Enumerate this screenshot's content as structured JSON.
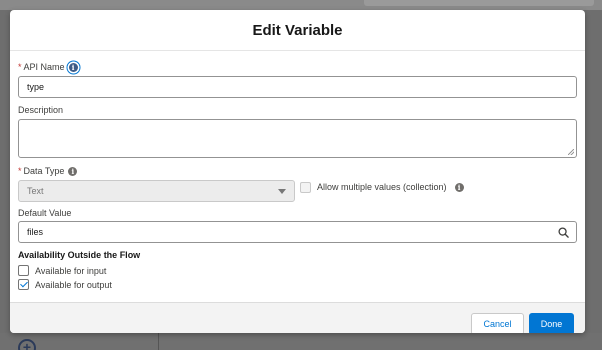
{
  "modal": {
    "title": "Edit Variable"
  },
  "fields": {
    "api_name": {
      "label": "API Name",
      "required": "*",
      "value": "type"
    },
    "description": {
      "label": "Description",
      "value": ""
    },
    "data_type": {
      "label": "Data Type",
      "required": "*",
      "value": "Text"
    },
    "allow_multiple": {
      "label": "Allow multiple values (collection)",
      "checked": false
    },
    "default_value": {
      "label": "Default Value",
      "value": "files"
    },
    "availability": {
      "title": "Availability Outside the Flow",
      "input_label": "Available for input",
      "input_checked": false,
      "output_label": "Available for output",
      "output_checked": true
    }
  },
  "footer": {
    "cancel_label": "Cancel",
    "done_label": "Done"
  },
  "icons": {
    "info": "info-icon",
    "search": "search-icon",
    "dropdown": "chevron-down-icon",
    "add": "add-icon"
  },
  "colors": {
    "brand": "#0176d3",
    "required": "#c23934"
  }
}
